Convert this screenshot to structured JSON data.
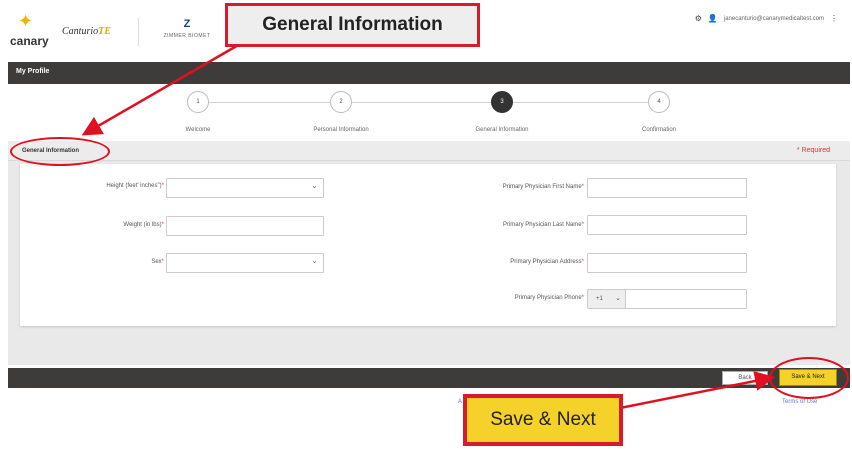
{
  "header": {
    "logo_canary": "canary",
    "logo_canturio": "Canturio",
    "logo_canturio_suffix": "TE",
    "logo_zimmer_mark": "Z",
    "logo_zimmer_text": "ZIMMER BIOMET",
    "user_email": "janecanturio@canarymedicaltest.com"
  },
  "profile_bar": {
    "title": "My Profile"
  },
  "stepper": {
    "steps": [
      {
        "number": "1",
        "label": "Welcome"
      },
      {
        "number": "2",
        "label": "Personal Information"
      },
      {
        "number": "3",
        "label": "General Information"
      },
      {
        "number": "4",
        "label": "Confirmation"
      }
    ],
    "active_step": 3
  },
  "section": {
    "title": "General Information",
    "required_note": "* Required"
  },
  "form": {
    "height_label": "Height (feet' inches\")",
    "weight_label": "Weight (in lbs)",
    "sex_label": "Sex",
    "physician_first_label": "Primary Physician First Name",
    "physician_last_label": "Primary Physician Last Name",
    "physician_address_label": "Primary Physician Address",
    "physician_phone_label": "Primary Physician Phone",
    "phone_code": "+1",
    "required_star": "*"
  },
  "footer": {
    "back_label": "Back",
    "save_next_label": "Save & Next",
    "link_left": "A",
    "link_right": "Terms of Use"
  },
  "annotations": {
    "general_info_callout": "General Information",
    "save_next_callout": "Save & Next",
    "accent_color": "#d81b2c"
  },
  "colors": {
    "bar_dark": "#3e3c3a",
    "button_yellow": "#f4d22a",
    "required_red": "#dd3333"
  }
}
